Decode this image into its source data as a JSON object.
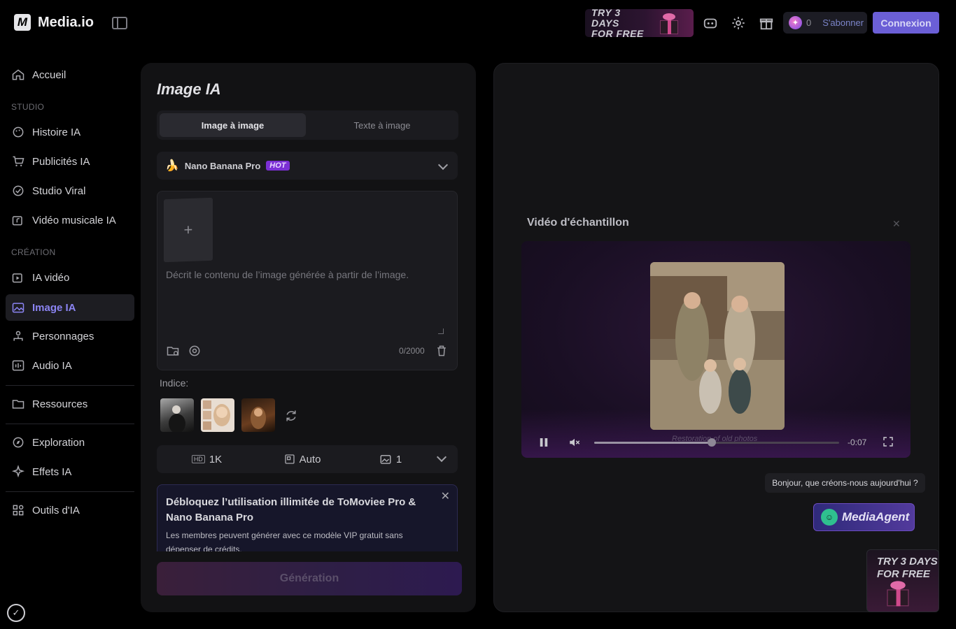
{
  "header": {
    "logo_mark": "M",
    "logo_text": "Media.io",
    "promo_text_line1": "TRY 3 DAYS",
    "promo_text_line2": "FOR FREE",
    "credits": "0",
    "subscribe_label": "S'abonner",
    "login_label": "Connexion"
  },
  "sidebar": {
    "home": "Accueil",
    "section_studio": "STUDIO",
    "studio_items": [
      "Histoire IA",
      "Publicités IA",
      "Studio Viral",
      "Vidéo musicale IA"
    ],
    "section_creation": "CRÉATION",
    "creation_items": [
      "IA vidéo",
      "Image IA",
      "Personnages",
      "Audio IA"
    ],
    "resources": "Ressources",
    "exploration": "Exploration",
    "effects": "Effets IA",
    "tools": "Outils d'IA",
    "active_item": "Image IA"
  },
  "panel": {
    "title": "Image IA",
    "tab_active": "Image à image",
    "tab_inactive": "Texte à image",
    "model_name": "Nano Banana Pro",
    "model_badge": "HOT",
    "upload_plus": "+",
    "prompt_placeholder": "Décrit le contenu de l’image générée à partir de l’image.",
    "char_counter": "0/2000",
    "hint_label": "Indice:",
    "option_quality": "1K",
    "option_quality_badge": "HD",
    "option_ratio": "Auto",
    "option_count": "1",
    "vip_title": "Débloquez l’utilisation illimitée de ToMoviee Pro & Nano Banana Pro",
    "vip_text": "Les membres peuvent générer avec ce modèle VIP gratuit sans dépenser de crédits.",
    "generate_label": "Génération"
  },
  "sample": {
    "title": "Vidéo d'échantillon",
    "caption": "Restoration of old photos",
    "time": "-0:07",
    "progress": 0.48
  },
  "assistant": {
    "greeting": "Bonjour, que créons-nous aujourd'hui ?",
    "agent_label": "MediaAgent"
  },
  "corner_promo": {
    "line1": "TRY 3 DAYS",
    "line2": "FOR FREE"
  },
  "colors": {
    "accent": "#6b5fd6",
    "active_nav": "#8b84f2",
    "hot_badge": "#7b2fd4"
  }
}
